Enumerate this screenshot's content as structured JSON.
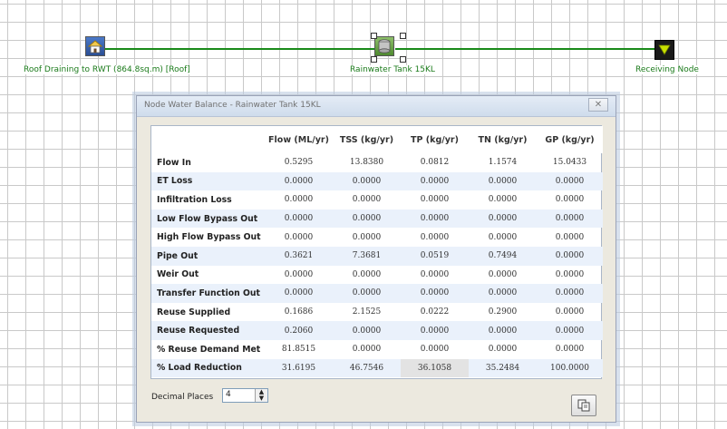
{
  "canvas": {
    "nodes": [
      {
        "id": "source",
        "label": "Roof Draining to RWT (864.8sq.m) [Roof]",
        "icon": "house-icon"
      },
      {
        "id": "tank",
        "label": "Rainwater Tank 15KL",
        "icon": "tank-icon"
      },
      {
        "id": "receiving",
        "label": "Receiving Node",
        "icon": "receiving-node-icon"
      }
    ],
    "link_color": "#1a8a1a"
  },
  "dialog": {
    "title": "Node Water Balance - Rainwater Tank 15KL",
    "close_icon": "close-icon",
    "table": {
      "columns": [
        "",
        "Flow (ML/yr)",
        "TSS (kg/yr)",
        "TP (kg/yr)",
        "TN (kg/yr)",
        "GP (kg/yr)"
      ],
      "rows": [
        {
          "label": "Flow In",
          "values": [
            "0.5295",
            "13.8380",
            "0.0812",
            "1.1574",
            "15.0433"
          ]
        },
        {
          "label": "ET Loss",
          "values": [
            "0.0000",
            "0.0000",
            "0.0000",
            "0.0000",
            "0.0000"
          ]
        },
        {
          "label": "Infiltration Loss",
          "values": [
            "0.0000",
            "0.0000",
            "0.0000",
            "0.0000",
            "0.0000"
          ]
        },
        {
          "label": "Low Flow Bypass Out",
          "values": [
            "0.0000",
            "0.0000",
            "0.0000",
            "0.0000",
            "0.0000"
          ]
        },
        {
          "label": "High Flow Bypass Out",
          "values": [
            "0.0000",
            "0.0000",
            "0.0000",
            "0.0000",
            "0.0000"
          ]
        },
        {
          "label": "Pipe Out",
          "values": [
            "0.3621",
            "7.3681",
            "0.0519",
            "0.7494",
            "0.0000"
          ]
        },
        {
          "label": "Weir Out",
          "values": [
            "0.0000",
            "0.0000",
            "0.0000",
            "0.0000",
            "0.0000"
          ]
        },
        {
          "label": "Transfer Function Out",
          "values": [
            "0.0000",
            "0.0000",
            "0.0000",
            "0.0000",
            "0.0000"
          ]
        },
        {
          "label": "Reuse Supplied",
          "values": [
            "0.1686",
            "2.1525",
            "0.0222",
            "0.2900",
            "0.0000"
          ]
        },
        {
          "label": "Reuse Requested",
          "values": [
            "0.2060",
            "0.0000",
            "0.0000",
            "0.0000",
            "0.0000"
          ]
        },
        {
          "label": "% Reuse Demand Met",
          "values": [
            "81.8515",
            "0.0000",
            "0.0000",
            "0.0000",
            "0.0000"
          ]
        },
        {
          "label": "% Load Reduction",
          "values": [
            "31.6195",
            "46.7546",
            "36.1058",
            "35.2484",
            "100.0000"
          ]
        }
      ]
    },
    "decimal_places": {
      "label": "Decimal Places",
      "value": "4"
    },
    "copy_button_icon": "copy-icon"
  }
}
